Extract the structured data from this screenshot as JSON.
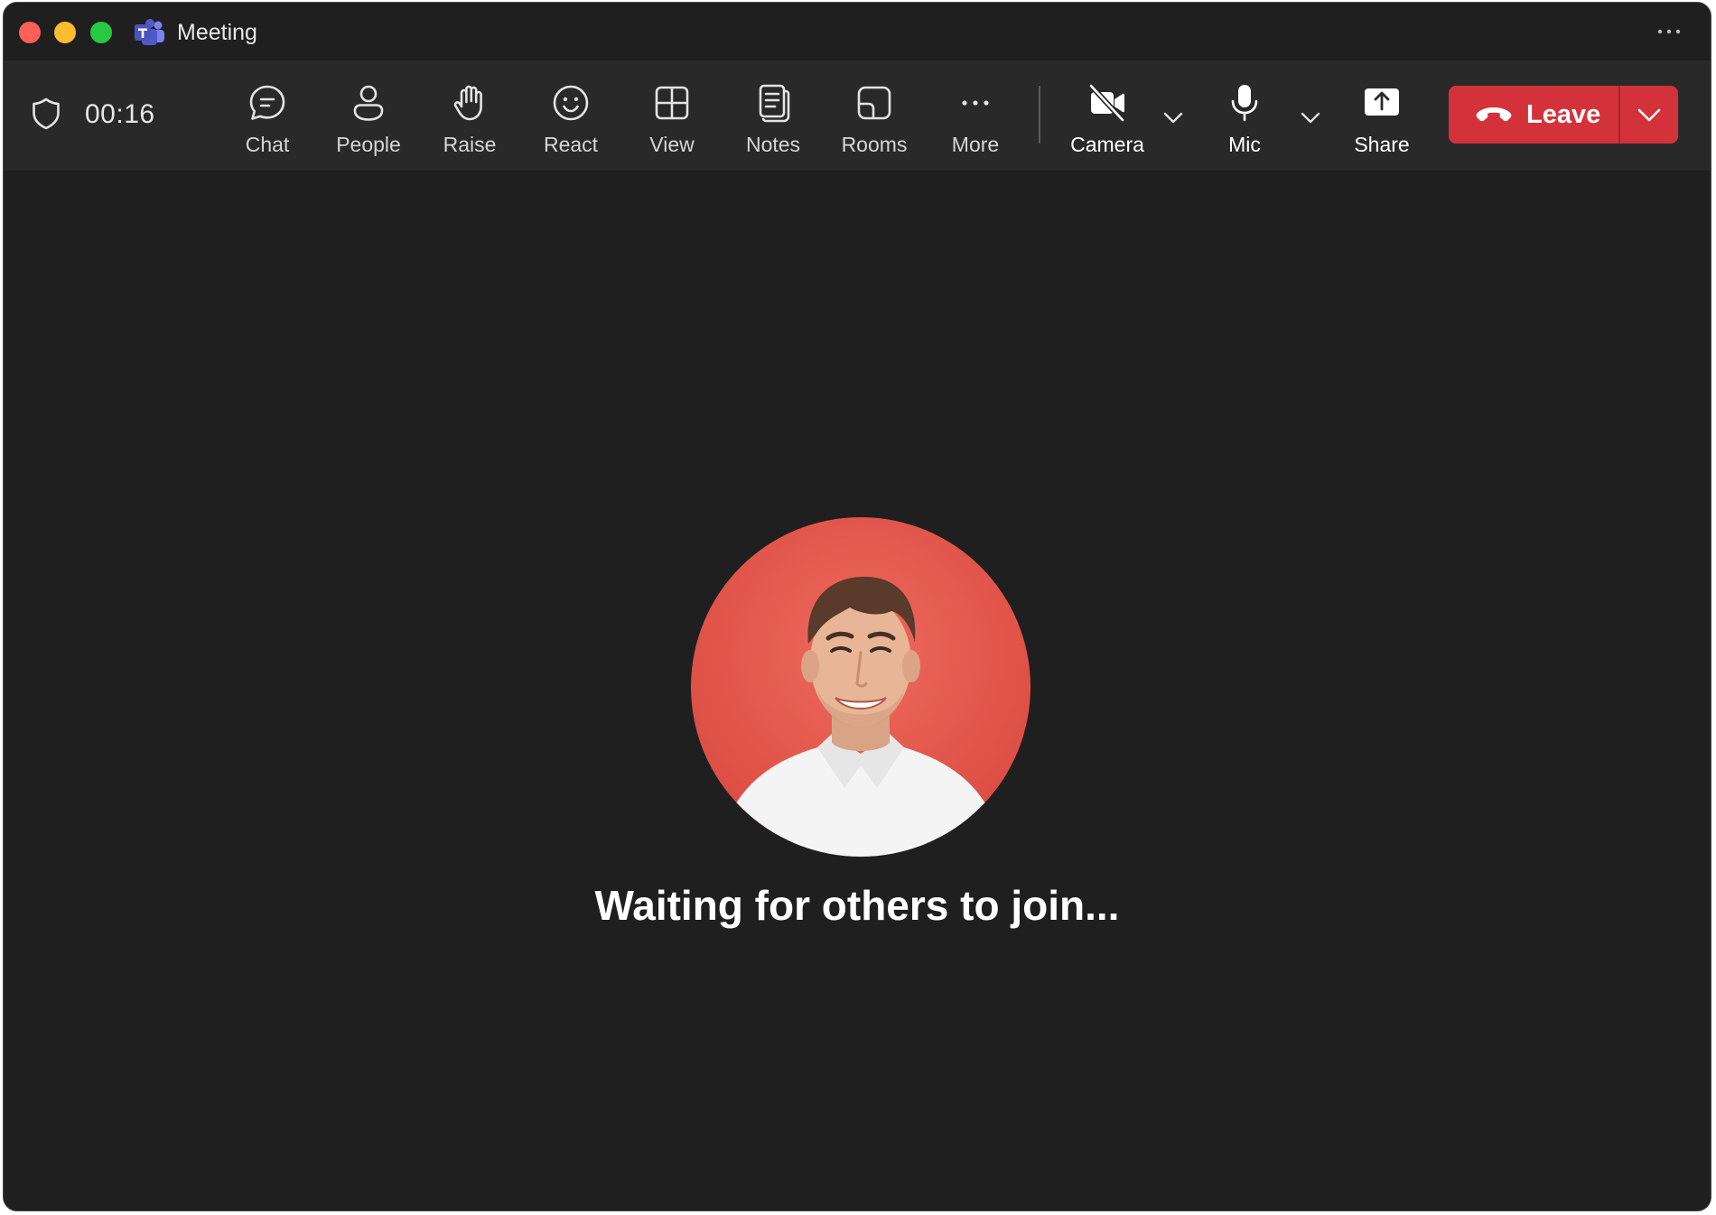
{
  "window": {
    "title": "Meeting"
  },
  "toolbar": {
    "timer": "00:16",
    "buttons": [
      {
        "label": "Chat",
        "icon": "chat-icon"
      },
      {
        "label": "People",
        "icon": "people-icon"
      },
      {
        "label": "Raise",
        "icon": "raise-hand-icon"
      },
      {
        "label": "React",
        "icon": "react-icon"
      },
      {
        "label": "View",
        "icon": "view-grid-icon"
      },
      {
        "label": "Notes",
        "icon": "notes-icon"
      },
      {
        "label": "Rooms",
        "icon": "rooms-icon"
      },
      {
        "label": "More",
        "icon": "more-icon"
      }
    ],
    "camera": {
      "label": "Camera",
      "icon": "camera-off-icon",
      "state": "off"
    },
    "mic": {
      "label": "Mic",
      "icon": "microphone-icon",
      "state": "on"
    },
    "share": {
      "label": "Share",
      "icon": "share-icon"
    },
    "leave": {
      "label": "Leave",
      "icon": "hang-up-icon"
    }
  },
  "stage": {
    "status": "Waiting for others to join...",
    "participant_avatar": "participant-avatar"
  },
  "colors": {
    "window_bg": "#1f1f1f",
    "toolbar_bg": "#292929",
    "leave_red": "#d3323a",
    "avatar_bg": "#e05a50",
    "text": "#ffffff"
  }
}
